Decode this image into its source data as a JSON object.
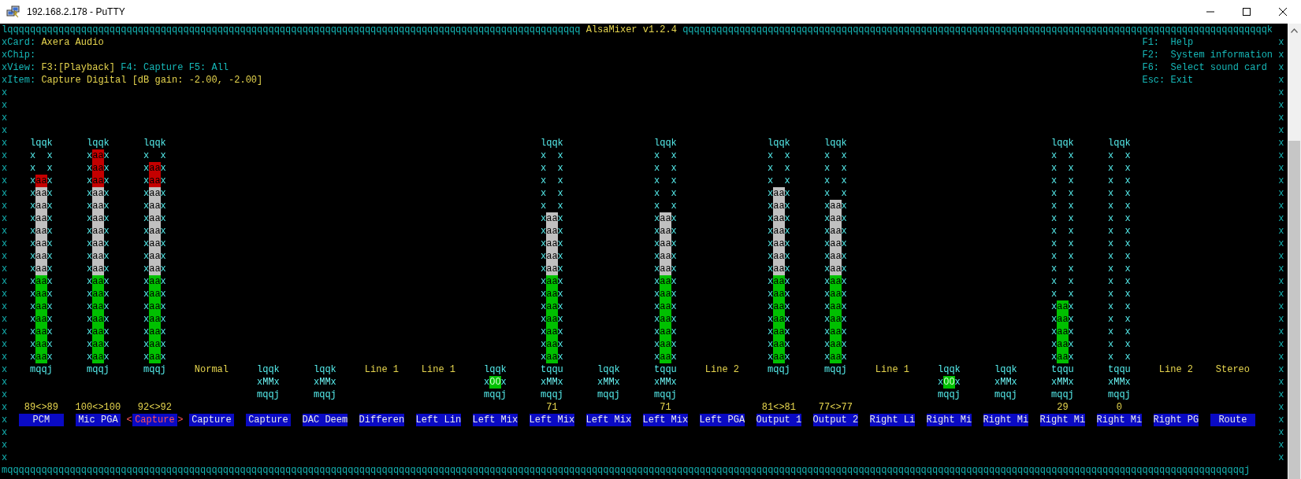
{
  "window": {
    "title": "192.168.2.178 - PuTTY"
  },
  "frame": {
    "top_left": "lqqqqqqqqqqqqqqqqqqqqqqqqqqqqqqqqqqqqqqqqqqqqqqqqqqqqqqqqqqqqqqqqqqqqqqqqqqqqqqqqqqqqqqqqqqqqqqqqqqqqq",
    "title": "AlsaMixer v1.2.4",
    "top_right": "qqqqqqqqqqqqqqqqqqqqqqqqqqqqqqqqqqqqqqqqqqqqqqqqqqqqqqqqqqqqqqqqqqqqqqqqqqqqqqqqqqqqqqqqqqqqqqqqqqqqqqqk",
    "left_side": [
      "x",
      "x",
      "x",
      "x",
      "x",
      "x",
      "x",
      "x",
      "x",
      "x",
      "x",
      "x",
      "x",
      "x",
      "x",
      "x",
      "x",
      "x",
      "x",
      "x",
      "x",
      "x",
      "x",
      "x",
      "x",
      "x",
      "x",
      "x",
      "x",
      "x",
      "x",
      "x",
      "x",
      "x"
    ],
    "right_side": [
      "x",
      "x",
      "x",
      "x",
      "x",
      "x",
      "x",
      "x",
      "x",
      "x",
      "x",
      "x",
      "x",
      "x",
      "x",
      "x",
      "x",
      "x",
      "x",
      "x",
      "x",
      "x",
      "x",
      "x",
      "x",
      "x",
      "x",
      "x",
      "x",
      "x",
      "x",
      "x",
      "x",
      "x"
    ],
    "bottom": "mqqqqqqqqqqqqqqqqqqqqqqqqqqqqqqqqqqqqqqqqqqqqqqqqqqqqqqqqqqqqqqqqqqqqqqqqqqqqqqqqqqqqqqqqqqqqqqqqqqqqqqqqqqqqqqqqqqqqqqqqqqqqqqqqqqqqqqqqqqqqqqqqqqqqqqqqqqqqqqqqqqqqqqqqqqqqqqqqqqqqqqqqqqqqqqqqqqqqqqqqqqqqqqqqqqqqqqqqqqj"
  },
  "info": [
    {
      "label": "Card:",
      "value": "Axera Audio"
    },
    {
      "label": "Chip:"
    },
    {
      "label": "View:",
      "views": [
        {
          "text": "F3:[Playback]",
          "selected": true
        },
        {
          "text": "F4: Capture",
          "selected": false
        },
        {
          "text": "F5: All",
          "selected": false
        }
      ]
    },
    {
      "label": "Item:",
      "value": "Capture Digital [dB gain: -2.00, -2.00]"
    }
  ],
  "help": [
    {
      "key": "F1:",
      "text": "Help"
    },
    {
      "key": "F2:",
      "text": "System information"
    },
    {
      "key": "F6:",
      "text": "Select sound card"
    },
    {
      "key": "Esc:",
      "text": "Exit"
    }
  ],
  "selection_marks": {
    "left": "<",
    "right": ">"
  },
  "controls": [
    {
      "name": "PCM",
      "selected": false,
      "meter": {
        "top": "lqqk",
        "bottom": "mqqj",
        "rows": [
          {
            "left": "x",
            "right": "x"
          },
          {
            "left": "x",
            "right": "x"
          },
          {
            "left": "x",
            "fill": "aa",
            "color": "#c40000",
            "right": "x"
          },
          {
            "left": "x",
            "fill": "aa",
            "color": "#c0c0c0",
            "right": "x"
          },
          {
            "left": "x",
            "fill": "aa",
            "color": "#c0c0c0",
            "right": "x"
          },
          {
            "left": "x",
            "fill": "aa",
            "color": "#c0c0c0",
            "right": "x"
          },
          {
            "left": "x",
            "fill": "aa",
            "color": "#c0c0c0",
            "right": "x"
          },
          {
            "left": "x",
            "fill": "aa",
            "color": "#c0c0c0",
            "right": "x"
          },
          {
            "left": "x",
            "fill": "aa",
            "color": "#c0c0c0",
            "right": "x"
          },
          {
            "left": "x",
            "fill": "aa",
            "color": "#c0c0c0",
            "right": "x"
          },
          {
            "left": "x",
            "fill": "aa",
            "color": "#00c000",
            "right": "x"
          },
          {
            "left": "x",
            "fill": "aa",
            "color": "#00c000",
            "right": "x"
          },
          {
            "left": "x",
            "fill": "aa",
            "color": "#00c000",
            "right": "x"
          },
          {
            "left": "x",
            "fill": "aa",
            "color": "#00c000",
            "right": "x"
          },
          {
            "left": "x",
            "fill": "aa",
            "color": "#00c000",
            "right": "x"
          },
          {
            "left": "x",
            "fill": "aa",
            "color": "#00c000",
            "right": "x"
          },
          {
            "left": "x",
            "fill": "aa",
            "color": "#00c000",
            "right": "x"
          }
        ]
      },
      "value": "89<>89"
    },
    {
      "name": "Mic PGA",
      "selected": false,
      "meter": {
        "top": "lqqk",
        "bottom": "mqqj",
        "rows": [
          {
            "left": "x",
            "fill": "aa",
            "color": "#c40000",
            "right": "x"
          },
          {
            "left": "x",
            "fill": "aa",
            "color": "#c40000",
            "right": "x"
          },
          {
            "left": "x",
            "fill": "aa",
            "color": "#c40000",
            "right": "x"
          },
          {
            "left": "x",
            "fill": "aa",
            "color": "#c0c0c0",
            "right": "x"
          },
          {
            "left": "x",
            "fill": "aa",
            "color": "#c0c0c0",
            "right": "x"
          },
          {
            "left": "x",
            "fill": "aa",
            "color": "#c0c0c0",
            "right": "x"
          },
          {
            "left": "x",
            "fill": "aa",
            "color": "#c0c0c0",
            "right": "x"
          },
          {
            "left": "x",
            "fill": "aa",
            "color": "#c0c0c0",
            "right": "x"
          },
          {
            "left": "x",
            "fill": "aa",
            "color": "#c0c0c0",
            "right": "x"
          },
          {
            "left": "x",
            "fill": "aa",
            "color": "#c0c0c0",
            "right": "x"
          },
          {
            "left": "x",
            "fill": "aa",
            "color": "#00c000",
            "right": "x"
          },
          {
            "left": "x",
            "fill": "aa",
            "color": "#00c000",
            "right": "x"
          },
          {
            "left": "x",
            "fill": "aa",
            "color": "#00c000",
            "right": "x"
          },
          {
            "left": "x",
            "fill": "aa",
            "color": "#00c000",
            "right": "x"
          },
          {
            "left": "x",
            "fill": "aa",
            "color": "#00c000",
            "right": "x"
          },
          {
            "left": "x",
            "fill": "aa",
            "color": "#00c000",
            "right": "x"
          },
          {
            "left": "x",
            "fill": "aa",
            "color": "#00c000",
            "right": "x"
          }
        ]
      },
      "value": "100<>100"
    },
    {
      "name": "Capture",
      "selected": true,
      "meter": {
        "top": "lqqk",
        "bottom": "mqqj",
        "rows": [
          {
            "left": "x",
            "right": "x"
          },
          {
            "left": "x",
            "fill": "aa",
            "color": "#c40000",
            "right": "x"
          },
          {
            "left": "x",
            "fill": "aa",
            "color": "#c40000",
            "right": "x"
          },
          {
            "left": "x",
            "fill": "aa",
            "color": "#c0c0c0",
            "right": "x"
          },
          {
            "left": "x",
            "fill": "aa",
            "color": "#c0c0c0",
            "right": "x"
          },
          {
            "left": "x",
            "fill": "aa",
            "color": "#c0c0c0",
            "right": "x"
          },
          {
            "left": "x",
            "fill": "aa",
            "color": "#c0c0c0",
            "right": "x"
          },
          {
            "left": "x",
            "fill": "aa",
            "color": "#c0c0c0",
            "right": "x"
          },
          {
            "left": "x",
            "fill": "aa",
            "color": "#c0c0c0",
            "right": "x"
          },
          {
            "left": "x",
            "fill": "aa",
            "color": "#c0c0c0",
            "right": "x"
          },
          {
            "left": "x",
            "fill": "aa",
            "color": "#00c000",
            "right": "x"
          },
          {
            "left": "x",
            "fill": "aa",
            "color": "#00c000",
            "right": "x"
          },
          {
            "left": "x",
            "fill": "aa",
            "color": "#00c000",
            "right": "x"
          },
          {
            "left": "x",
            "fill": "aa",
            "color": "#00c000",
            "right": "x"
          },
          {
            "left": "x",
            "fill": "aa",
            "color": "#00c000",
            "right": "x"
          },
          {
            "left": "x",
            "fill": "aa",
            "color": "#00c000",
            "right": "x"
          },
          {
            "left": "x",
            "fill": "aa",
            "color": "#00c000",
            "right": "x"
          }
        ]
      },
      "value": "92<>92"
    },
    {
      "name": "Capture",
      "selected": false,
      "enum": "Normal"
    },
    {
      "name": "Capture",
      "selected": false,
      "switch": {
        "top": "lqqk",
        "left": "x",
        "state": "MM",
        "on": false,
        "right": "x",
        "bottom": "mqqj"
      }
    },
    {
      "name": "DAC Deem",
      "selected": false,
      "switch": {
        "top": "lqqk",
        "left": "x",
        "state": "MM",
        "on": false,
        "right": "x",
        "bottom": "mqqj"
      }
    },
    {
      "name": "Differen",
      "selected": false,
      "enum": "Line 1"
    },
    {
      "name": "Left Lin",
      "selected": false,
      "enum": "Line 1"
    },
    {
      "name": "Left Mix",
      "selected": false,
      "switch": {
        "top": "lqqk",
        "left": "x",
        "state": "OO",
        "on": true,
        "right": "x",
        "bottom": "mqqj"
      }
    },
    {
      "name": "Left Mix",
      "selected": false,
      "meter": {
        "top": "lqqk",
        "rows": [
          {
            "left": "x",
            "right": "x"
          },
          {
            "left": "x",
            "right": "x"
          },
          {
            "left": "x",
            "right": "x"
          },
          {
            "left": "x",
            "right": "x"
          },
          {
            "left": "x",
            "right": "x"
          },
          {
            "left": "x",
            "fill": "aa",
            "color": "#c0c0c0",
            "right": "x"
          },
          {
            "left": "x",
            "fill": "aa",
            "color": "#c0c0c0",
            "right": "x"
          },
          {
            "left": "x",
            "fill": "aa",
            "color": "#c0c0c0",
            "right": "x"
          },
          {
            "left": "x",
            "fill": "aa",
            "color": "#c0c0c0",
            "right": "x"
          },
          {
            "left": "x",
            "fill": "aa",
            "color": "#c0c0c0",
            "right": "x"
          },
          {
            "left": "x",
            "fill": "aa",
            "color": "#00c000",
            "right": "x"
          },
          {
            "left": "x",
            "fill": "aa",
            "color": "#00c000",
            "right": "x"
          },
          {
            "left": "x",
            "fill": "aa",
            "color": "#00c000",
            "right": "x"
          },
          {
            "left": "x",
            "fill": "aa",
            "color": "#00c000",
            "right": "x"
          },
          {
            "left": "x",
            "fill": "aa",
            "color": "#00c000",
            "right": "x"
          },
          {
            "left": "x",
            "fill": "aa",
            "color": "#00c000",
            "right": "x"
          },
          {
            "left": "x",
            "fill": "aa",
            "color": "#00c000",
            "right": "x"
          }
        ]
      },
      "switch": {
        "top": "tqqu",
        "left": "x",
        "state": "MM",
        "on": false,
        "right": "x",
        "bottom": "mqqj"
      },
      "value": "71"
    },
    {
      "name": "Left Mix",
      "selected": false,
      "switch": {
        "top": "lqqk",
        "left": "x",
        "state": "MM",
        "on": false,
        "right": "x",
        "bottom": "mqqj"
      }
    },
    {
      "name": "Left Mix",
      "selected": false,
      "meter": {
        "top": "lqqk",
        "rows": [
          {
            "left": "x",
            "right": "x"
          },
          {
            "left": "x",
            "right": "x"
          },
          {
            "left": "x",
            "right": "x"
          },
          {
            "left": "x",
            "right": "x"
          },
          {
            "left": "x",
            "right": "x"
          },
          {
            "left": "x",
            "fill": "aa",
            "color": "#c0c0c0",
            "right": "x"
          },
          {
            "left": "x",
            "fill": "aa",
            "color": "#c0c0c0",
            "right": "x"
          },
          {
            "left": "x",
            "fill": "aa",
            "color": "#c0c0c0",
            "right": "x"
          },
          {
            "left": "x",
            "fill": "aa",
            "color": "#c0c0c0",
            "right": "x"
          },
          {
            "left": "x",
            "fill": "aa",
            "color": "#c0c0c0",
            "right": "x"
          },
          {
            "left": "x",
            "fill": "aa",
            "color": "#00c000",
            "right": "x"
          },
          {
            "left": "x",
            "fill": "aa",
            "color": "#00c000",
            "right": "x"
          },
          {
            "left": "x",
            "fill": "aa",
            "color": "#00c000",
            "right": "x"
          },
          {
            "left": "x",
            "fill": "aa",
            "color": "#00c000",
            "right": "x"
          },
          {
            "left": "x",
            "fill": "aa",
            "color": "#00c000",
            "right": "x"
          },
          {
            "left": "x",
            "fill": "aa",
            "color": "#00c000",
            "right": "x"
          },
          {
            "left": "x",
            "fill": "aa",
            "color": "#00c000",
            "right": "x"
          }
        ]
      },
      "switch": {
        "top": "tqqu",
        "left": "x",
        "state": "MM",
        "on": false,
        "right": "x",
        "bottom": "mqqj"
      },
      "value": "71"
    },
    {
      "name": "Left PGA",
      "selected": false,
      "enum": "Line 2"
    },
    {
      "name": "Output 1",
      "selected": false,
      "meter": {
        "top": "lqqk",
        "bottom": "mqqj",
        "rows": [
          {
            "left": "x",
            "right": "x"
          },
          {
            "left": "x",
            "right": "x"
          },
          {
            "left": "x",
            "right": "x"
          },
          {
            "left": "x",
            "fill": "aa",
            "color": "#c0c0c0",
            "right": "x"
          },
          {
            "left": "x",
            "fill": "aa",
            "color": "#c0c0c0",
            "right": "x"
          },
          {
            "left": "x",
            "fill": "aa",
            "color": "#c0c0c0",
            "right": "x"
          },
          {
            "left": "x",
            "fill": "aa",
            "color": "#c0c0c0",
            "right": "x"
          },
          {
            "left": "x",
            "fill": "aa",
            "color": "#c0c0c0",
            "right": "x"
          },
          {
            "left": "x",
            "fill": "aa",
            "color": "#c0c0c0",
            "right": "x"
          },
          {
            "left": "x",
            "fill": "aa",
            "color": "#c0c0c0",
            "right": "x"
          },
          {
            "left": "x",
            "fill": "aa",
            "color": "#00c000",
            "right": "x"
          },
          {
            "left": "x",
            "fill": "aa",
            "color": "#00c000",
            "right": "x"
          },
          {
            "left": "x",
            "fill": "aa",
            "color": "#00c000",
            "right": "x"
          },
          {
            "left": "x",
            "fill": "aa",
            "color": "#00c000",
            "right": "x"
          },
          {
            "left": "x",
            "fill": "aa",
            "color": "#00c000",
            "right": "x"
          },
          {
            "left": "x",
            "fill": "aa",
            "color": "#00c000",
            "right": "x"
          },
          {
            "left": "x",
            "fill": "aa",
            "color": "#00c000",
            "right": "x"
          }
        ]
      },
      "value": "81<>81"
    },
    {
      "name": "Output 2",
      "selected": false,
      "meter": {
        "top": "lqqk",
        "bottom": "mqqj",
        "rows": [
          {
            "left": "x",
            "right": "x"
          },
          {
            "left": "x",
            "right": "x"
          },
          {
            "left": "x",
            "right": "x"
          },
          {
            "left": "x",
            "right": "x"
          },
          {
            "left": "x",
            "fill": "aa",
            "color": "#c0c0c0",
            "right": "x"
          },
          {
            "left": "x",
            "fill": "aa",
            "color": "#c0c0c0",
            "right": "x"
          },
          {
            "left": "x",
            "fill": "aa",
            "color": "#c0c0c0",
            "right": "x"
          },
          {
            "left": "x",
            "fill": "aa",
            "color": "#c0c0c0",
            "right": "x"
          },
          {
            "left": "x",
            "fill": "aa",
            "color": "#c0c0c0",
            "right": "x"
          },
          {
            "left": "x",
            "fill": "aa",
            "color": "#c0c0c0",
            "right": "x"
          },
          {
            "left": "x",
            "fill": "aa",
            "color": "#00c000",
            "right": "x"
          },
          {
            "left": "x",
            "fill": "aa",
            "color": "#00c000",
            "right": "x"
          },
          {
            "left": "x",
            "fill": "aa",
            "color": "#00c000",
            "right": "x"
          },
          {
            "left": "x",
            "fill": "aa",
            "color": "#00c000",
            "right": "x"
          },
          {
            "left": "x",
            "fill": "aa",
            "color": "#00c000",
            "right": "x"
          },
          {
            "left": "x",
            "fill": "aa",
            "color": "#00c000",
            "right": "x"
          },
          {
            "left": "x",
            "fill": "aa",
            "color": "#00c000",
            "right": "x"
          }
        ]
      },
      "value": "77<>77"
    },
    {
      "name": "Right Li",
      "selected": false,
      "enum": "Line 1"
    },
    {
      "name": "Right Mi",
      "selected": false,
      "switch": {
        "top": "lqqk",
        "left": "x",
        "state": "OO",
        "on": true,
        "right": "x",
        "bottom": "mqqj"
      }
    },
    {
      "name": "Right Mi",
      "selected": false,
      "switch": {
        "top": "lqqk",
        "left": "x",
        "state": "MM",
        "on": false,
        "right": "x",
        "bottom": "mqqj"
      }
    },
    {
      "name": "Right Mi",
      "selected": false,
      "meter": {
        "top": "lqqk",
        "rows": [
          {
            "left": "x",
            "right": "x"
          },
          {
            "left": "x",
            "right": "x"
          },
          {
            "left": "x",
            "right": "x"
          },
          {
            "left": "x",
            "right": "x"
          },
          {
            "left": "x",
            "right": "x"
          },
          {
            "left": "x",
            "right": "x"
          },
          {
            "left": "x",
            "right": "x"
          },
          {
            "left": "x",
            "right": "x"
          },
          {
            "left": "x",
            "right": "x"
          },
          {
            "left": "x",
            "right": "x"
          },
          {
            "left": "x",
            "right": "x"
          },
          {
            "left": "x",
            "right": "x"
          },
          {
            "left": "x",
            "fill": "aa",
            "color": "#00c000",
            "right": "x"
          },
          {
            "left": "x",
            "fill": "aa",
            "color": "#00c000",
            "right": "x"
          },
          {
            "left": "x",
            "fill": "aa",
            "color": "#00c000",
            "right": "x"
          },
          {
            "left": "x",
            "fill": "aa",
            "color": "#00c000",
            "right": "x"
          },
          {
            "left": "x",
            "fill": "aa",
            "color": "#00c000",
            "right": "x"
          }
        ]
      },
      "switch": {
        "top": "tqqu",
        "left": "x",
        "state": "MM",
        "on": false,
        "right": "x",
        "bottom": "mqqj"
      },
      "value": "29"
    },
    {
      "name": "Right Mi",
      "selected": false,
      "meter": {
        "top": "lqqk",
        "rows": [
          {
            "left": "x",
            "right": "x"
          },
          {
            "left": "x",
            "right": "x"
          },
          {
            "left": "x",
            "right": "x"
          },
          {
            "left": "x",
            "right": "x"
          },
          {
            "left": "x",
            "right": "x"
          },
          {
            "left": "x",
            "right": "x"
          },
          {
            "left": "x",
            "right": "x"
          },
          {
            "left": "x",
            "right": "x"
          },
          {
            "left": "x",
            "right": "x"
          },
          {
            "left": "x",
            "right": "x"
          },
          {
            "left": "x",
            "right": "x"
          },
          {
            "left": "x",
            "right": "x"
          },
          {
            "left": "x",
            "right": "x"
          },
          {
            "left": "x",
            "right": "x"
          },
          {
            "left": "x",
            "right": "x"
          },
          {
            "left": "x",
            "right": "x"
          },
          {
            "left": "x",
            "right": "x"
          }
        ]
      },
      "switch": {
        "top": "tqqu",
        "left": "x",
        "state": "MM",
        "on": false,
        "right": "x",
        "bottom": "mqqj"
      },
      "value": "0"
    },
    {
      "name": "Right PG",
      "selected": false,
      "enum": "Line 2"
    },
    {
      "name": "Route",
      "selected": false,
      "enum": "Stereo"
    }
  ]
}
